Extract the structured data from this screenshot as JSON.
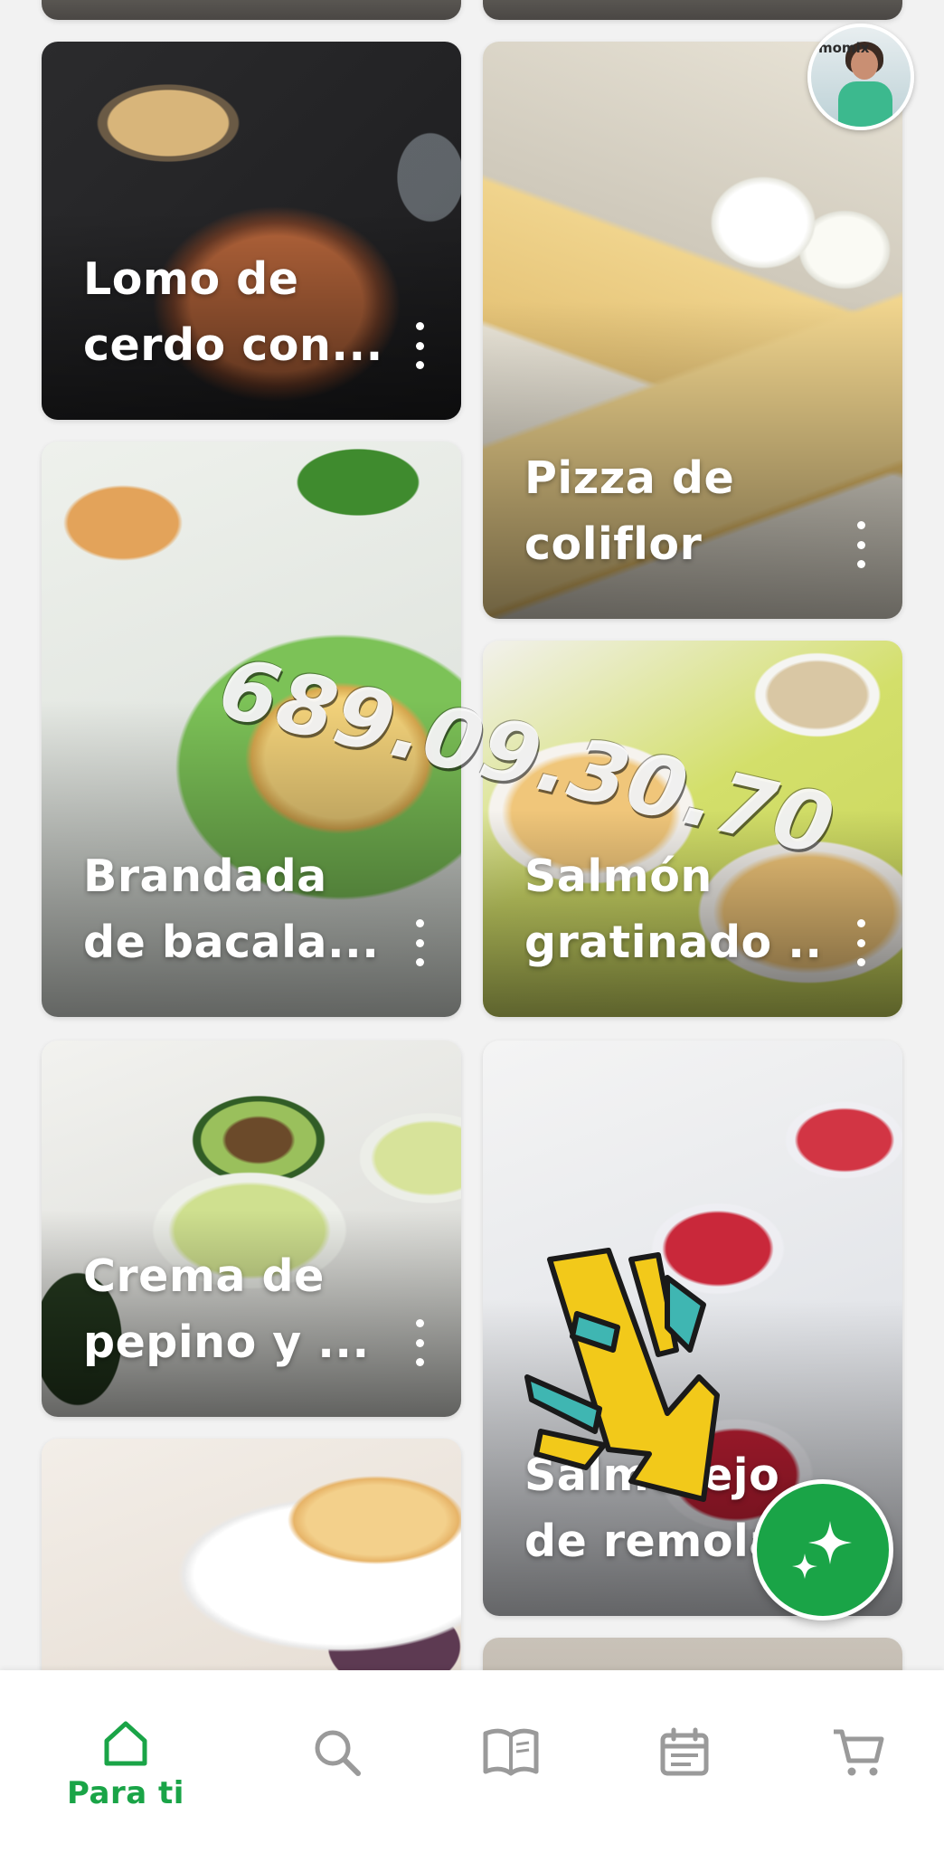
{
  "feed": {
    "cards": [
      {
        "id": "lomo",
        "line1": "Lomo de",
        "line2": "cerdo con..."
      },
      {
        "id": "pizza",
        "line1": "Pizza de",
        "line2": "coliflor"
      },
      {
        "id": "brandada",
        "line1": "Brandada",
        "line2": "de bacala..."
      },
      {
        "id": "salmon",
        "line1": "Salmón",
        "line2": "gratinado ..."
      },
      {
        "id": "crema",
        "line1": "Crema de",
        "line2": "pepino y ..."
      },
      {
        "id": "remolacha",
        "line1": "Salmorejo",
        "line2": "de remola..."
      }
    ]
  },
  "overlay": {
    "watermark": "689.09.30.70",
    "avatar_brand": "momix"
  },
  "bottom_nav": {
    "items": [
      {
        "icon": "home-icon",
        "label": "Para ti",
        "active": true
      },
      {
        "icon": "search-icon"
      },
      {
        "icon": "book-icon"
      },
      {
        "icon": "calendar-icon"
      },
      {
        "icon": "cart-icon"
      }
    ]
  },
  "colors": {
    "accent": "#1aa447",
    "inactive_icon": "#9a9a9a",
    "card_title": "#ffffff"
  }
}
